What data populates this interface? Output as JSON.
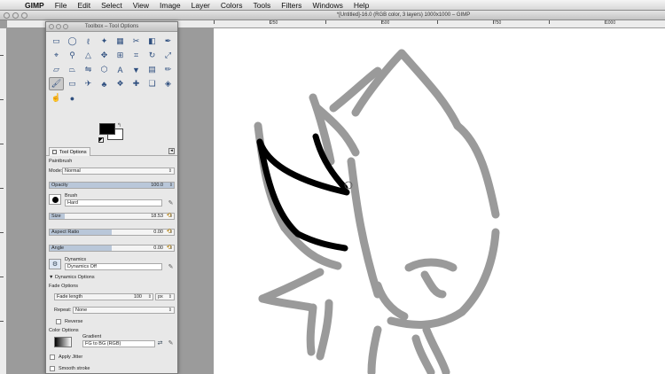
{
  "menubar": {
    "app": "GIMP",
    "items": [
      "File",
      "Edit",
      "Select",
      "View",
      "Image",
      "Layer",
      "Colors",
      "Tools",
      "Filters",
      "Windows",
      "Help"
    ]
  },
  "image_window": {
    "title": "*[Untitled]-16.0 (RGB color, 3 layers) 1000x1000 – GIMP",
    "ruler_labels": [
      "250",
      "500",
      "750",
      "1000"
    ]
  },
  "toolbox": {
    "title": "Toolbox – Tool Options",
    "tools": [
      {
        "icon": "rect-select-icon",
        "glyph": "▭"
      },
      {
        "icon": "ellipse-select-icon",
        "glyph": "◯"
      },
      {
        "icon": "free-select-icon",
        "glyph": "ℓ"
      },
      {
        "icon": "fuzzy-select-icon",
        "glyph": "✦"
      },
      {
        "icon": "color-select-icon",
        "glyph": "▦"
      },
      {
        "icon": "scissors-icon",
        "glyph": "✂"
      },
      {
        "icon": "foreground-select-icon",
        "glyph": "◧"
      },
      {
        "icon": "paths-icon",
        "glyph": "✒"
      },
      {
        "icon": "color-picker-icon",
        "glyph": "⌖"
      },
      {
        "icon": "zoom-icon",
        "glyph": "⚲"
      },
      {
        "icon": "measure-icon",
        "glyph": "△"
      },
      {
        "icon": "move-icon",
        "glyph": "✥"
      },
      {
        "icon": "align-icon",
        "glyph": "⊞"
      },
      {
        "icon": "crop-icon",
        "glyph": "⌗"
      },
      {
        "icon": "rotate-icon",
        "glyph": "↻"
      },
      {
        "icon": "scale-icon",
        "glyph": "⤢"
      },
      {
        "icon": "shear-icon",
        "glyph": "▱"
      },
      {
        "icon": "perspective-icon",
        "glyph": "⏢"
      },
      {
        "icon": "flip-icon",
        "glyph": "⇋"
      },
      {
        "icon": "cage-icon",
        "glyph": "⬡"
      },
      {
        "icon": "text-icon",
        "glyph": "A"
      },
      {
        "icon": "bucket-fill-icon",
        "glyph": "▼"
      },
      {
        "icon": "blend-icon",
        "glyph": "▤"
      },
      {
        "icon": "pencil-icon",
        "glyph": "✏"
      },
      {
        "icon": "paintbrush-icon",
        "glyph": "🖌"
      },
      {
        "icon": "eraser-icon",
        "glyph": "▭"
      },
      {
        "icon": "airbrush-icon",
        "glyph": "✈"
      },
      {
        "icon": "ink-icon",
        "glyph": "♣"
      },
      {
        "icon": "clone-icon",
        "glyph": "❖"
      },
      {
        "icon": "heal-icon",
        "glyph": "✚"
      },
      {
        "icon": "perspective-clone-icon",
        "glyph": "❏"
      },
      {
        "icon": "blur-sharpen-icon",
        "glyph": "◈"
      },
      {
        "icon": "smudge-icon",
        "glyph": "☝"
      },
      {
        "icon": "dodge-burn-icon",
        "glyph": "●"
      }
    ],
    "active_tool_index": 24,
    "colors": {
      "foreground": "#000000",
      "background": "#ffffff"
    }
  },
  "tool_options": {
    "tab_label": "Tool Options",
    "tool_name": "Paintbrush",
    "mode_label": "Mode:",
    "mode_value": "Normal",
    "opacity_label": "Opacity",
    "opacity_value": "100.0",
    "opacity_fraction": 1.0,
    "brush_label": "Brush",
    "brush_value": "Hard",
    "size_label": "Size",
    "size_value": "18.53",
    "size_fraction": 0.12,
    "aspect_label": "Aspect Ratio",
    "aspect_value": "0.00",
    "aspect_fraction": 0.5,
    "angle_label": "Angle",
    "angle_value": "0.00",
    "angle_fraction": 0.5,
    "dynamics_label": "Dynamics",
    "dynamics_value": "Dynamics Off",
    "dynamics_options_label": "Dynamics Options",
    "fade_options_label": "Fade Options",
    "fade_length_label": "Fade length",
    "fade_length_value": "100",
    "fade_length_unit": "px",
    "repeat_label": "Repeat:",
    "repeat_value": "None",
    "reverse_label": "Reverse",
    "color_options_label": "Color Options",
    "gradient_label": "Gradient",
    "gradient_value": "FG to BG (RGB)",
    "apply_jitter_label": "Apply Jitter",
    "smooth_stroke_label": "Smooth stroke"
  }
}
